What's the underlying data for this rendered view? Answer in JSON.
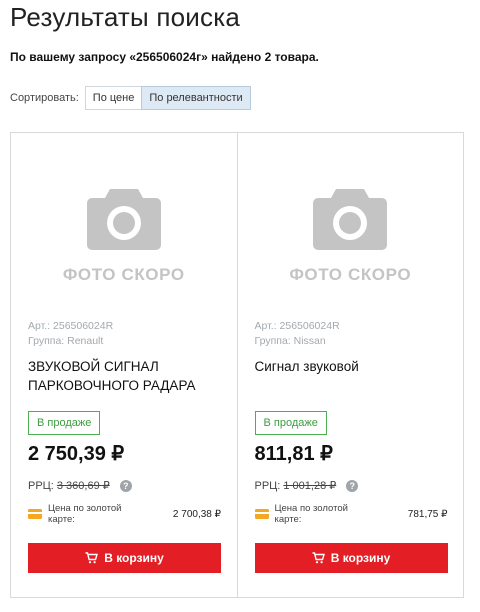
{
  "page": {
    "title": "Результаты поиска",
    "summary": "По вашему запросу «256506024г» найдено 2 товара."
  },
  "sort": {
    "label": "Сортировать:",
    "options": [
      "По цене",
      "По релевантности"
    ],
    "active": "По релевантности"
  },
  "placeholder_text": "ФОТО СКОРО",
  "cart_label": "В корзину",
  "products": [
    {
      "article": "Арт.: 256506024R",
      "group": "Группа: Renault",
      "name": "ЗВУКОВОЙ СИГНАЛ ПАРКОВОЧНОГО РАДАРА",
      "availability": "В продаже",
      "price": "2 750,39 ₽",
      "rrp_label": "РРЦ:",
      "rrp_value": "3 360,69 ₽",
      "gold_label": "Цена по золотой карте:",
      "gold_price": "2 700,38 ₽"
    },
    {
      "article": "Арт.: 256506024R",
      "group": "Группа: Nissan",
      "name": "Сигнал звуковой",
      "availability": "В продаже",
      "price": "811,81 ₽",
      "rrp_label": "РРЦ:",
      "rrp_value": "1 001,28 ₽",
      "gold_label": "Цена по золотой карте:",
      "gold_price": "781,75 ₽"
    }
  ],
  "colors": {
    "accent_red": "#e31e24",
    "in_stock_green": "#4caf50",
    "gold_card": "#f5a623",
    "active_sort_bg": "#dde9f5"
  },
  "icons": {
    "placeholder": "camera-icon",
    "help": "question-icon",
    "card": "gold-card-icon",
    "cart": "cart-icon"
  }
}
